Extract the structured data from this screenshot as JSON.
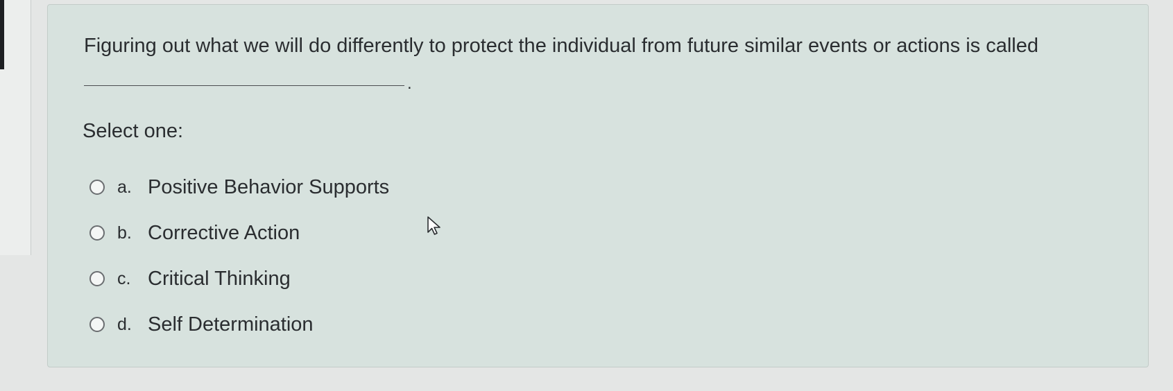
{
  "question": {
    "text": "Figuring out what we will do differently to protect the individual from future similar events or actions is called",
    "blank_suffix": ".",
    "prompt": "Select one:"
  },
  "options": [
    {
      "letter": "a.",
      "text": "Positive Behavior Supports"
    },
    {
      "letter": "b.",
      "text": "Corrective Action"
    },
    {
      "letter": "c.",
      "text": "Critical Thinking"
    },
    {
      "letter": "d.",
      "text": "Self Determination"
    }
  ],
  "colors": {
    "page_background": "#e4e6e5",
    "card_background": "#d7e2de",
    "text": "#2a2d30"
  },
  "icons": {
    "radio": "radio-button-icon",
    "cursor": "mouse-pointer-icon"
  }
}
